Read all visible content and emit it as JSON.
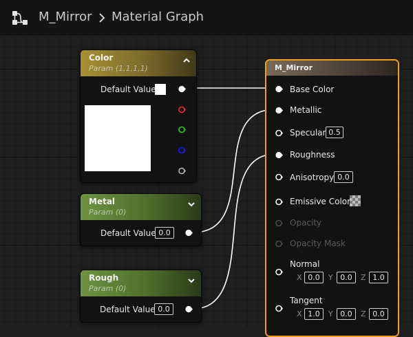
{
  "breadcrumb": {
    "asset": "M_Mirror",
    "graph": "Material Graph"
  },
  "icons": {
    "graph": "graph-icon",
    "chevron": "chevron-right-icon"
  },
  "color_node": {
    "title": "Color",
    "subtitle": "Param (1,1,1,1)",
    "default_label": "Default Value",
    "pin_colors": [
      "#ffffff",
      "#ff2b2b",
      "#1fd21f",
      "#1c1cff",
      "#b8b8b8"
    ]
  },
  "metal_node": {
    "title": "Metal",
    "subtitle": "Param (0)",
    "default_label": "Default Value",
    "default_value": "0.0"
  },
  "rough_node": {
    "title": "Rough",
    "subtitle": "Param (0)",
    "default_label": "Default Value",
    "default_value": "0.0"
  },
  "material_node": {
    "title": "M_Mirror",
    "base_color": "Base Color",
    "metallic": "Metallic",
    "specular": "Specular",
    "specular_value": "0.5",
    "roughness": "Roughness",
    "anisotropy": "Anisotropy",
    "anisotropy_value": "0.0",
    "emissive": "Emissive Color",
    "opacity": "Opacity",
    "opacity_mask": "Opacity Mask",
    "normal": {
      "label": "Normal",
      "x": "0.0",
      "y": "0.0",
      "z": "1.0"
    },
    "tangent": {
      "label": "Tangent",
      "x": "1.0",
      "y": "0.0",
      "z": "0.0"
    },
    "axes": {
      "x": "X",
      "y": "Y",
      "z": "Z"
    }
  },
  "colors": {
    "accent": "#f1a01e",
    "color_header": "#8f7a2c",
    "param_header": "#5c7c33",
    "material_header": "#6b5a4a"
  }
}
